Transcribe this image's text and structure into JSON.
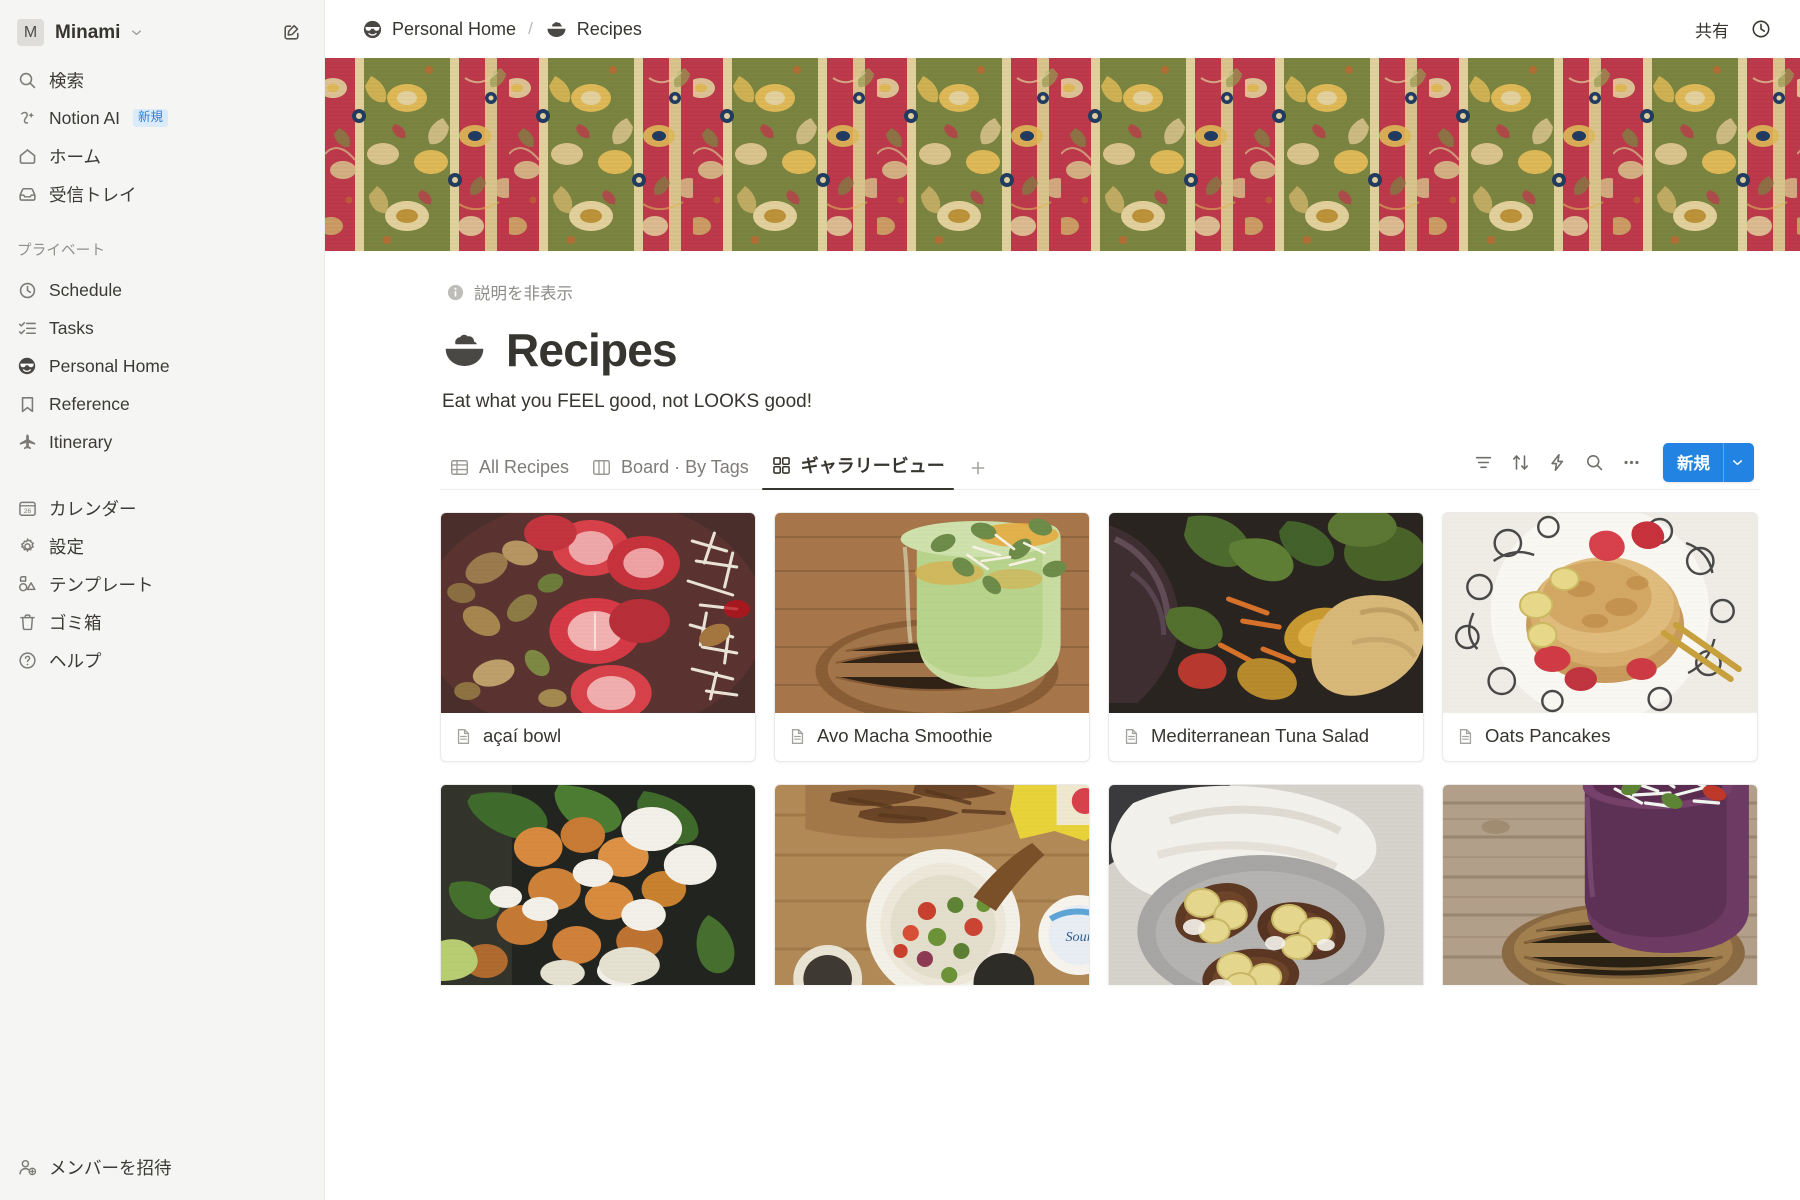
{
  "sidebar": {
    "workspace": {
      "initial": "M",
      "name": "Minami",
      "chevron_icon": "chevron-down-icon",
      "edit_icon": "new-page-icon"
    },
    "quick_items": [
      {
        "icon": "search-icon",
        "label": "検索"
      },
      {
        "icon": "notion-ai-icon",
        "label": "Notion AI",
        "badge": "新規"
      },
      {
        "icon": "home-icon",
        "label": "ホーム"
      },
      {
        "icon": "inbox-icon",
        "label": "受信トレイ"
      }
    ],
    "private_section_title": "プライベート",
    "private_items": [
      {
        "icon": "clock-icon",
        "label": "Schedule"
      },
      {
        "icon": "checklist-icon",
        "label": "Tasks"
      },
      {
        "icon": "cool-face-emoji",
        "label": "Personal Home"
      },
      {
        "icon": "bookmark-icon",
        "label": "Reference"
      },
      {
        "icon": "airplane-icon",
        "label": "Itinerary"
      }
    ],
    "utility_items": [
      {
        "icon": "calendar-26-icon",
        "label": "カレンダー"
      },
      {
        "icon": "gear-icon",
        "label": "設定"
      },
      {
        "icon": "template-icon",
        "label": "テンプレート"
      },
      {
        "icon": "trash-icon",
        "label": "ゴミ箱"
      },
      {
        "icon": "help-circle-icon",
        "label": "ヘルプ"
      }
    ],
    "invite": {
      "icon": "person-plus-icon",
      "label": "メンバーを招待"
    }
  },
  "topbar": {
    "breadcrumb": [
      {
        "icon": "cool-face-emoji",
        "label": "Personal Home"
      },
      {
        "icon": "bowl-emoji",
        "label": "Recipes"
      }
    ],
    "separator": "/",
    "share_label": "共有",
    "history_icon": "clock-icon"
  },
  "cover": {
    "description": "persian-carpet-pattern",
    "colors": {
      "crimson": "#C4394E",
      "olive": "#7E8A43",
      "gold": "#E8C25C",
      "cream": "#EDDCA6",
      "navy": "#1F3C66",
      "rust": "#C96B34"
    }
  },
  "page": {
    "description_toggle": {
      "icon": "info-icon",
      "label": "説明を非表示"
    },
    "emoji": "bowl-emoji",
    "title": "Recipes",
    "subtitle": "Eat what you FEEL good, not LOOKS good!"
  },
  "views": {
    "tabs": [
      {
        "icon": "table-icon",
        "label": "All Recipes",
        "active": false
      },
      {
        "icon": "board-icon",
        "label": "Board · By Tags",
        "active": false
      },
      {
        "icon": "gallery-icon",
        "label": "ギャラリービュー",
        "active": true
      }
    ],
    "add_view_icon": "plus-icon",
    "tools": [
      {
        "icon": "filter-icon",
        "name": "filter"
      },
      {
        "icon": "sort-icon",
        "name": "sort"
      },
      {
        "icon": "lightning-icon",
        "name": "automation"
      },
      {
        "icon": "search-icon",
        "name": "search"
      },
      {
        "icon": "ellipsis-icon",
        "name": "more-options"
      }
    ],
    "new_button": {
      "label": "新規",
      "chevron_icon": "chevron-down-icon",
      "color": "#2383E2"
    }
  },
  "gallery": {
    "icon": "page-icon",
    "cards": [
      {
        "title": "açaí bowl",
        "image": "acai-bowl-strawberries-nuts",
        "row": 1
      },
      {
        "title": "Avo Macha Smoothie",
        "image": "green-smoothie-glass-rattan",
        "row": 1
      },
      {
        "title": "Mediterranean Tuna Salad",
        "image": "grilled-vegetables-salad-bread",
        "row": 1
      },
      {
        "title": "Oats Pancakes",
        "image": "pancake-plate-banana-berries",
        "row": 1
      },
      {
        "title": "",
        "image": "chickpea-spinach-yogurt-bowl",
        "row": 2
      },
      {
        "title": "",
        "image": "salsa-bowl-wooden-table",
        "row": 2
      },
      {
        "title": "",
        "image": "banana-toast-grey-plate",
        "row": 2
      },
      {
        "title": "",
        "image": "purple-smoothie-coconut-rattan",
        "row": 2
      }
    ]
  }
}
